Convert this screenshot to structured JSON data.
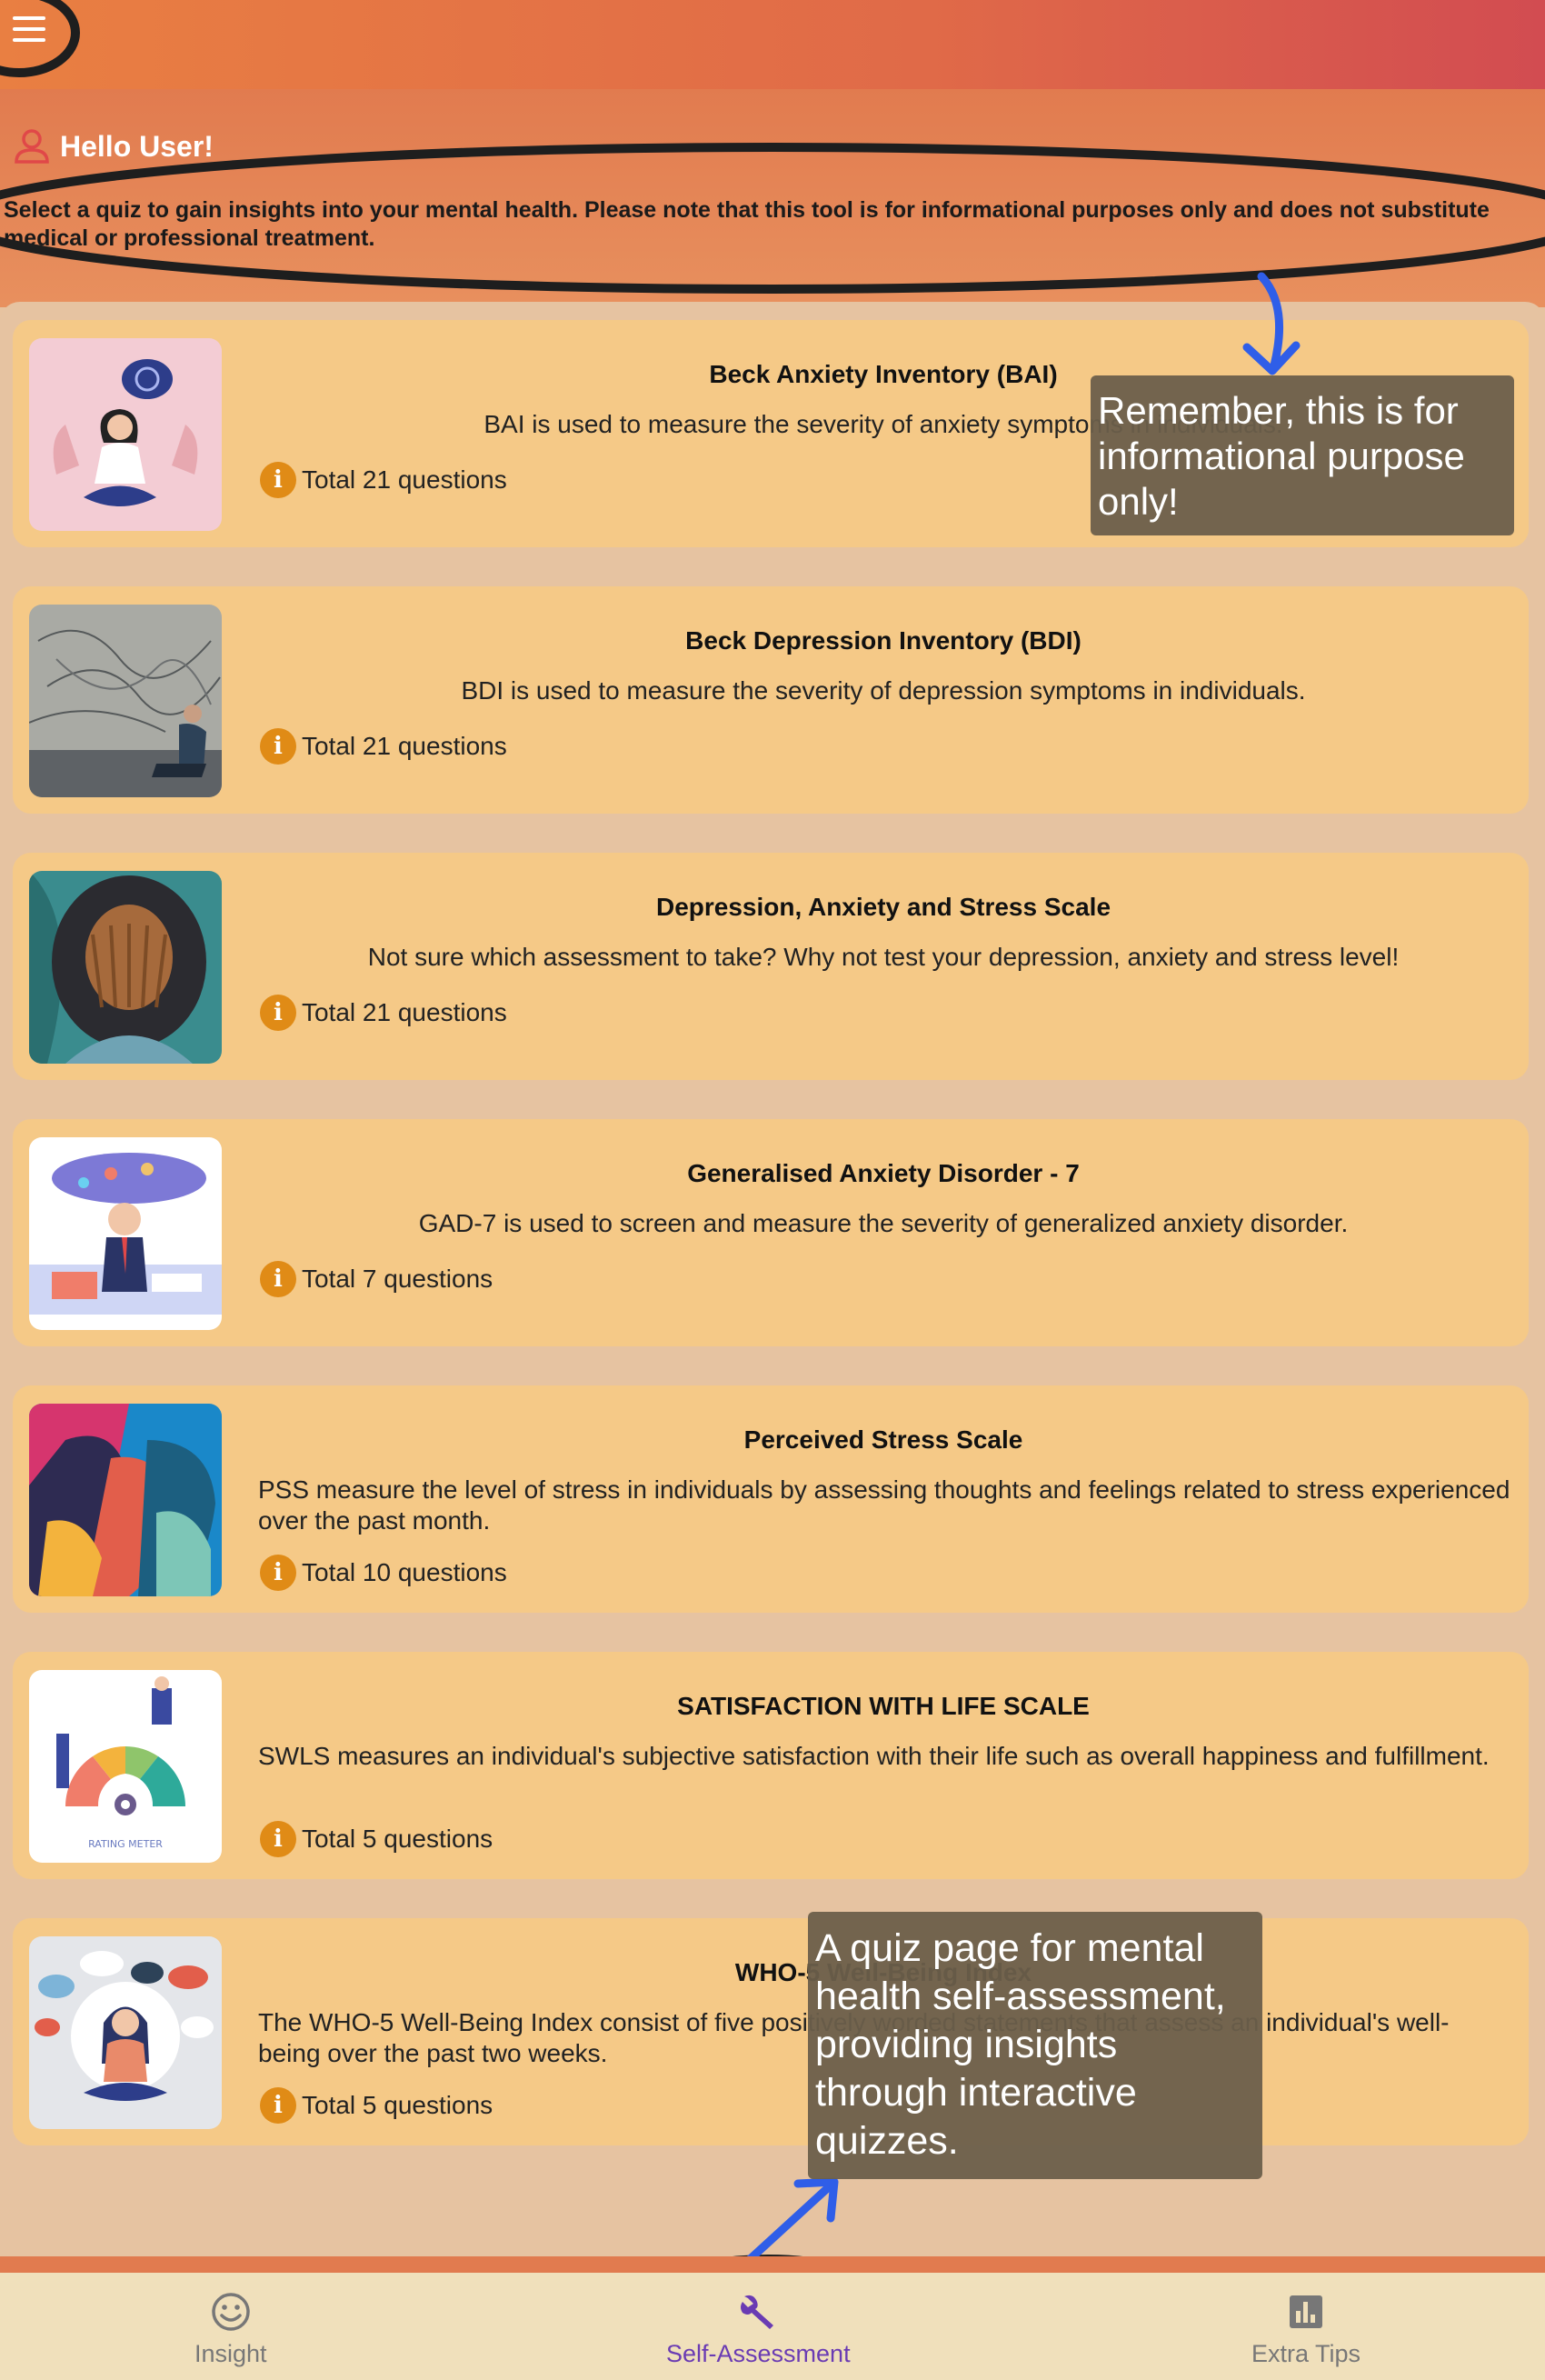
{
  "header": {
    "greeting": "Hello User!",
    "intro": "Select a quiz to gain insights into your mental health. Please note that this tool is for informational purposes only and does not substitute medical or professional treatment."
  },
  "quizzes": [
    {
      "title": "Beck Anxiety Inventory (BAI)",
      "description": "BAI is  used to measure the severity of anxiety symptoms in individuals.",
      "count": "Total 21 questions",
      "image": "anxious-woman-illustration"
    },
    {
      "title": "Beck Depression Inventory (BDI)",
      "description": "BDI is  used to measure the severity of depression symptoms in individuals.",
      "count": "Total 21 questions",
      "image": "tangled-thoughts-man-photo"
    },
    {
      "title": "Depression, Anxiety and Stress Scale",
      "description": "Not sure which assessment to take? Why not test your depression, anxiety and stress level!",
      "count": "Total 21 questions",
      "image": "face-in-hands-illustration"
    },
    {
      "title": "Generalised Anxiety Disorder - 7",
      "description": "GAD-7 is used to screen and measure the severity of generalized anxiety disorder.",
      "count": "Total 7 questions",
      "image": "stressed-office-worker-illustration"
    },
    {
      "title": "Perceived Stress Scale",
      "description": "PSS measure the level of stress in individuals by assessing thoughts and feelings related to stress experienced over the past month.",
      "count": "Total 10 questions",
      "image": "colorful-profiles-illustration"
    },
    {
      "title": "SATISFACTION WITH LIFE SCALE",
      "description": "SWLS measures an individual's subjective satisfaction with their life such as overall happiness and fulfillment.",
      "count": "Total 5 questions",
      "image": "rating-meter-illustration",
      "image_caption": "RATING METER"
    },
    {
      "title": "WHO-5 Well-Being Index",
      "description": "The WHO-5 Well-Being Index consist of five positively worded statements that assess an individual's well-being over the past two weeks.",
      "count": "Total 5 questions",
      "image": "meditating-woman-illustration"
    }
  ],
  "tooltips": {
    "top": "Remember, this is for informational purpose only!",
    "bottom": "A quiz page for mental health self-assessment, providing insights through interactive quizzes."
  },
  "nav": {
    "items": [
      {
        "label": "Insight",
        "icon": "smiley-icon",
        "active": false
      },
      {
        "label": "Self-Assessment",
        "icon": "wrench-icon",
        "active": true
      },
      {
        "label": "Extra Tips",
        "icon": "bar-chart-icon",
        "active": false
      }
    ]
  },
  "colors": {
    "topbar": "#e97f42",
    "card": "#f5c987",
    "info_icon": "#e08b16",
    "active_nav": "#6a3bb3",
    "annotation_arrow": "#2f5ee8"
  }
}
